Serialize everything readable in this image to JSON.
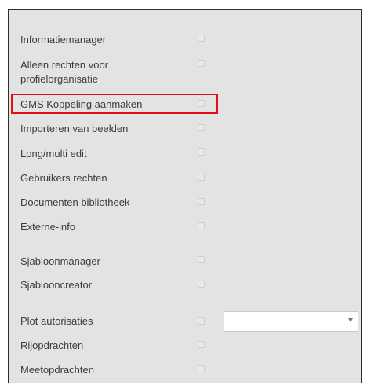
{
  "permissions": {
    "items": [
      {
        "label": "Informatiemanager",
        "checked": false
      },
      {
        "label": "Alleen rechten voor profielorganisatie",
        "checked": false
      },
      {
        "label": "GMS Koppeling aanmaken",
        "checked": false
      },
      {
        "label": "Importeren van beelden",
        "checked": false
      },
      {
        "label": "Long/multi edit",
        "checked": false
      },
      {
        "label": "Gebruikers rechten",
        "checked": false
      },
      {
        "label": "Documenten bibliotheek",
        "checked": false
      },
      {
        "label": "Externe-info",
        "checked": false
      },
      {
        "label": "Sjabloonmanager",
        "checked": false
      },
      {
        "label": "Sjablooncreator",
        "checked": false
      },
      {
        "label": "Plot autorisaties",
        "checked": false
      },
      {
        "label": "Rijopdrachten",
        "checked": false
      },
      {
        "label": "Meetopdrachten",
        "checked": false
      }
    ]
  },
  "plot_select": {
    "value": ""
  },
  "highlight": {
    "color": "#e0101a"
  }
}
